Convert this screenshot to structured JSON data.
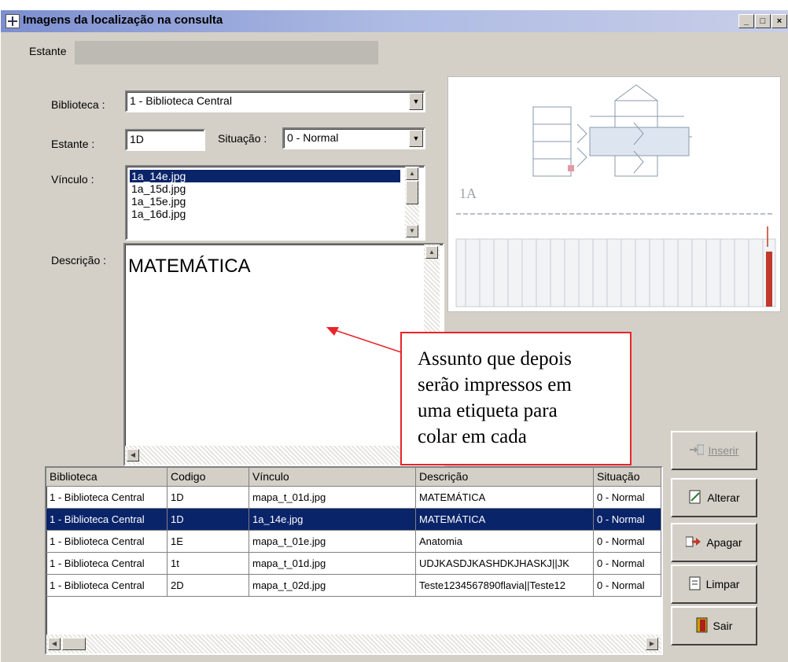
{
  "window": {
    "title": "Imagens da localização na consulta",
    "controls": [
      "_",
      "□",
      "×"
    ]
  },
  "tabs": [
    {
      "label": "Estante"
    }
  ],
  "form": {
    "biblioteca": {
      "label": "Biblioteca :",
      "value": "1 - Biblioteca Central"
    },
    "estante": {
      "label": "Estante :",
      "value": "1D"
    },
    "situacao": {
      "label": "Situação :",
      "value": "0 - Normal"
    },
    "vinculo": {
      "label": "Vínculo :",
      "items": [
        "1a_14e.jpg",
        "1a_15d.jpg",
        "1a_15e.jpg",
        "1a_16d.jpg"
      ],
      "selected_index": 0
    },
    "descricao": {
      "label": "Descrição :",
      "value": "MATEMÁTICA"
    }
  },
  "preview": {
    "label": "1A"
  },
  "annotation": {
    "lines": [
      "Assunto que depois",
      "serão impressos em",
      "uma etiqueta para",
      "colar em cada"
    ],
    "color": "#e8242a"
  },
  "grid": {
    "columns": [
      "Biblioteca",
      "Codigo",
      "Vínculo",
      "Descrição",
      "Situação"
    ],
    "rows": [
      [
        "1 - Biblioteca Central",
        "1D",
        "mapa_t_01d.jpg",
        "MATEMÁTICA",
        "0 - Normal"
      ],
      [
        "1 - Biblioteca Central",
        "1D",
        "1a_14e.jpg",
        "MATEMÁTICA",
        "0 - Normal"
      ],
      [
        "1 - Biblioteca Central",
        "1E",
        "mapa_t_01e.jpg",
        "Anatomia",
        "0 - Normal"
      ],
      [
        "1 - Biblioteca Central",
        "1t",
        "mapa_t_01d.jpg",
        "UDJKASDJKASHDKJHASKJ||JK",
        "0 - Normal"
      ],
      [
        "1 - Biblioteca Central",
        "2D",
        "mapa_t_02d.jpg",
        "Teste1234567890flavia||Teste12",
        "0 - Normal"
      ]
    ],
    "selected_row": 1
  },
  "buttons": {
    "inserir": "Inserir",
    "alterar": "Alterar",
    "apagar": "Apagar",
    "limpar": "Limpar",
    "sair": "Sair"
  },
  "colors": {
    "selection": "#0a246a",
    "face": "#d4d0c8",
    "accent_red": "#e8242a"
  }
}
